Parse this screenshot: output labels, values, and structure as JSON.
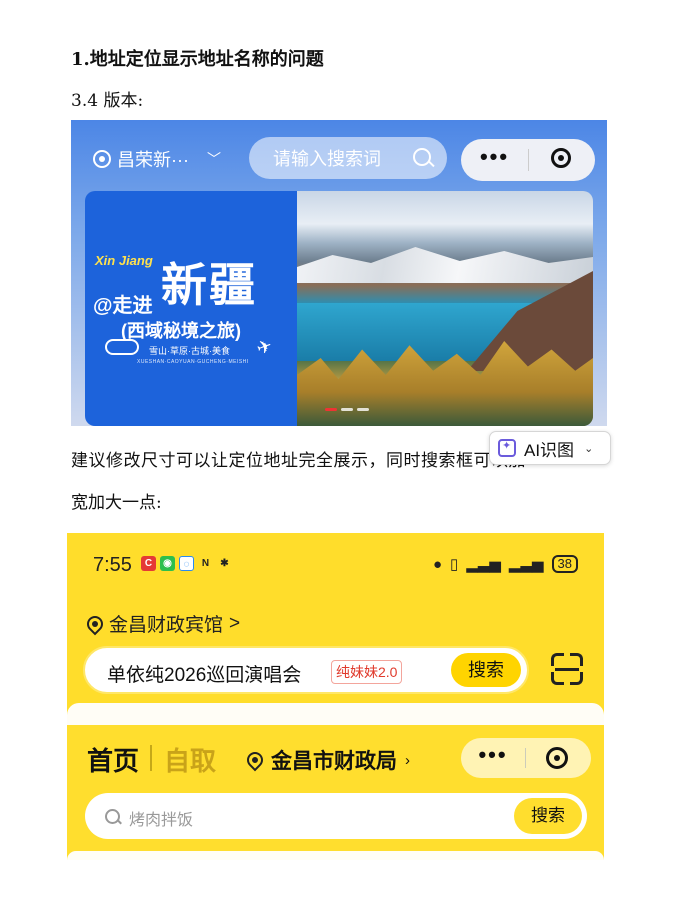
{
  "doc": {
    "heading": "1.地址定位显示地址名称的问题",
    "version": "3.4 版本:",
    "para1": "建议修改尺寸可以让定位地址完全展示，同时搜索框可以加",
    "para2": "宽加大一点:"
  },
  "shot1": {
    "location": "昌荣新···",
    "search_placeholder": "请输入搜索词",
    "more": "•••",
    "banner": {
      "xin_jiang": "Xin Jiang",
      "zou_jin": "@走进",
      "title": "新疆",
      "subtitle": "(西域秘境之旅)",
      "tags": "雪山·草原·古城·美食",
      "pinyin": "XUESHAN·CAOYUAN·GUCHENG·MEISHI"
    }
  },
  "ai_badge": {
    "label": "AI识图"
  },
  "shot2": {
    "time": "7:55",
    "battery": "38",
    "location": "金昌财政宾馆",
    "loc_arrow": ">",
    "search_keyword": "单依纯2026巡回演唱会",
    "search_tag": "纯妹妹2.0",
    "search_button": "搜索"
  },
  "shot3": {
    "tab_home": "首页",
    "tab_self": "自取",
    "location": "金昌市财政局",
    "loc_arrow": "›",
    "more": "•••",
    "search_placeholder": "烤肉拌饭",
    "search_button": "搜索"
  }
}
